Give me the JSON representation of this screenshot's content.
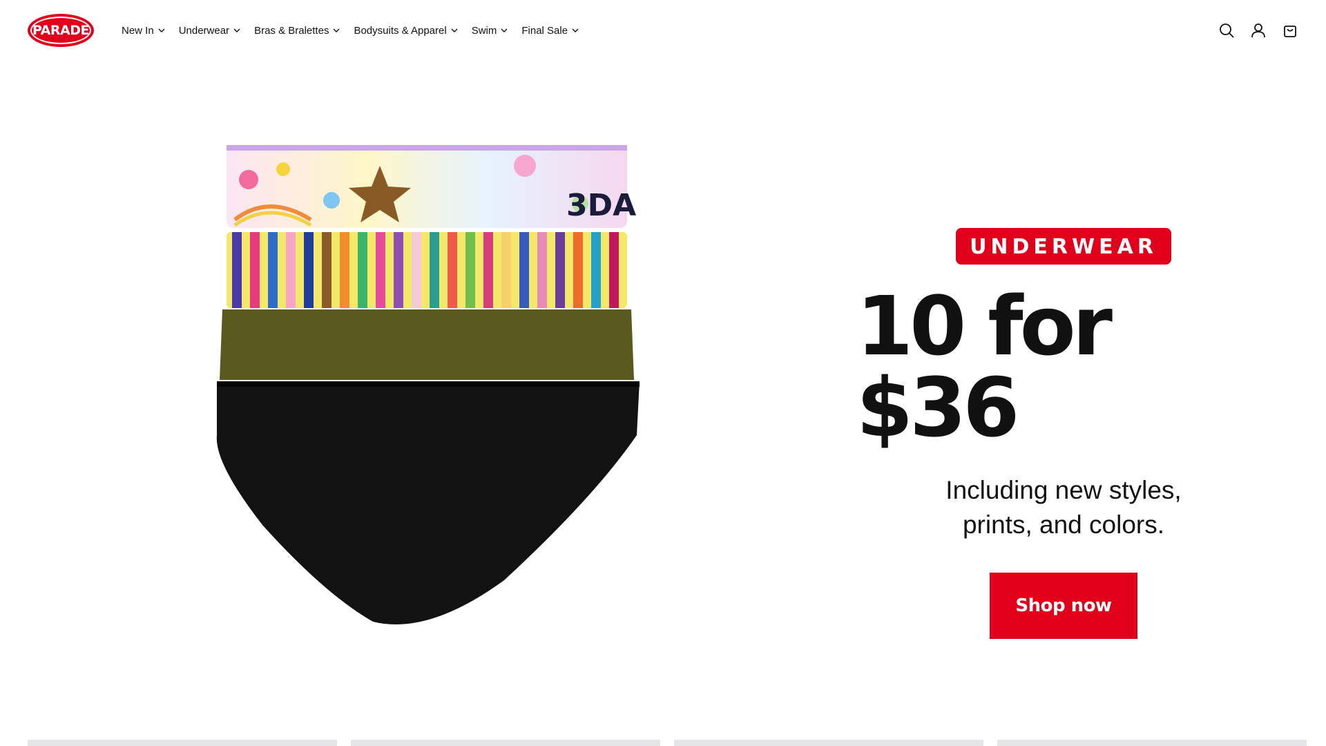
{
  "brand": {
    "logo_text": "PARADE",
    "accent": "#e0001b"
  },
  "nav": {
    "items": [
      {
        "label": "New In"
      },
      {
        "label": "Underwear"
      },
      {
        "label": "Bras & Bralettes"
      },
      {
        "label": "Bodysuits & Apparel"
      },
      {
        "label": "Swim"
      },
      {
        "label": "Final Sale"
      }
    ]
  },
  "header_icons": [
    "search-icon",
    "account-icon",
    "cart-icon"
  ],
  "promo": {
    "badge": "UNDERWEAR",
    "headline": "10 for $36",
    "subline": "Including new styles, prints, and colors.",
    "cta": "Shop now"
  }
}
